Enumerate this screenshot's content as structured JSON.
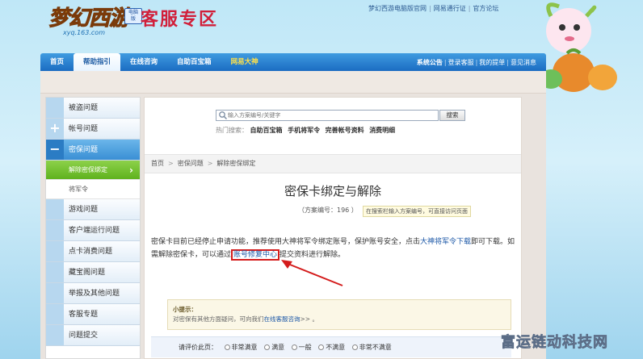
{
  "header": {
    "logo_text": "梦幻西游",
    "logo_badge": "电脑版",
    "logo_url": "xyq.163.com",
    "page_heading": "客服专区",
    "top_links": [
      "梦幻西游电脑版官网",
      "网易通行证",
      "官方论坛"
    ]
  },
  "nav": {
    "items": [
      {
        "label": "首页"
      },
      {
        "label": "帮助指引"
      },
      {
        "label": "在线咨询"
      },
      {
        "label": "自助百宝箱"
      },
      {
        "label": "网易大神"
      }
    ],
    "right_links": [
      "系统公告",
      "登录客服",
      "我的提单",
      "意见消息"
    ]
  },
  "sidebar": {
    "items": [
      {
        "label": "被盗问题"
      },
      {
        "label": "帐号问题"
      },
      {
        "label": "密保问题"
      },
      {
        "label": "解除密保绑定"
      },
      {
        "label": "将军令"
      },
      {
        "label": "游戏问题"
      },
      {
        "label": "客户端运行问题"
      },
      {
        "label": "点卡消费问题"
      },
      {
        "label": "藏宝阁问题"
      },
      {
        "label": "举报及其他问题"
      },
      {
        "label": "客服专题"
      },
      {
        "label": "问题提交"
      }
    ]
  },
  "search": {
    "placeholder": "输入方案编号/关键字",
    "button": "搜索",
    "hot_label": "热门搜索：",
    "hot_terms": [
      "自助百宝箱",
      "手机将军令",
      "完善帐号资料",
      "消费明细"
    ]
  },
  "breadcrumb": [
    "首页",
    "密保问题",
    "解除密保绑定"
  ],
  "article": {
    "title": "密保卡绑定与解除",
    "case_no": "（方案编号：196 ）",
    "case_tip": "在搜索栏输入方案编号，可直接访问页面",
    "body_part1": "密保卡目前已经停止申请功能，推荐使用大神将军令绑定账号，保护账号安全，点击",
    "body_link1": "大神将军令下载",
    "body_part2": "即可下载。如需解除密保卡，可以通过",
    "body_link2": "账号修复中心",
    "body_part3": "提交资料进行解除。"
  },
  "tip": {
    "title": "小提示：",
    "text": "对密保有其他方面疑问，可向我们",
    "link": "在线客服咨询",
    "suffix": ">> 。"
  },
  "rating": {
    "label": "请评价此页：",
    "options": [
      "非常满意",
      "满意",
      "一般",
      "不满意",
      "非常不满意"
    ]
  },
  "watermark": "富运链动科技网",
  "colors": {
    "nav_blue": "#1b6cc2",
    "heading_red": "#d11f3a",
    "sidebar_active_green": "#5fb21e",
    "highlight_red": "#d41c1c",
    "link_blue": "#1a56a6"
  }
}
